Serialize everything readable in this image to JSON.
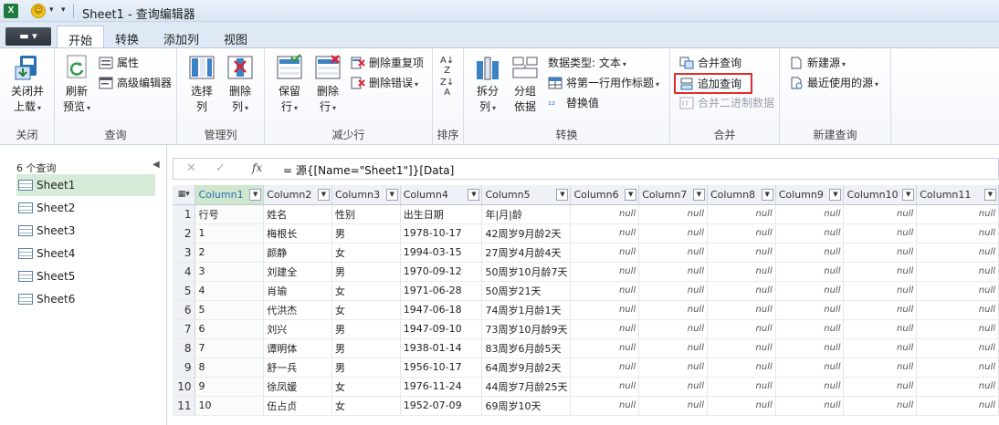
{
  "window": {
    "title": "Sheet1 - 查询编辑器",
    "app_logo_text": "X"
  },
  "tabs": [
    {
      "label": "开始",
      "active": true
    },
    {
      "label": "转换",
      "active": false
    },
    {
      "label": "添加列",
      "active": false
    },
    {
      "label": "视图",
      "active": false
    }
  ],
  "ribbon": {
    "close": {
      "btn_line1": "关闭并",
      "btn_line2": "上载",
      "group": "关闭"
    },
    "query": {
      "refresh_line1": "刷新",
      "refresh_line2": "预览",
      "properties": "属性",
      "advanced_editor": "高级编辑器",
      "group": "查询"
    },
    "manage_cols": {
      "select_line1": "选择",
      "select_line2": "列",
      "remove_line1": "删除",
      "remove_line2": "列",
      "group": "管理列"
    },
    "reduce_rows": {
      "keep_line1": "保留",
      "keep_line2": "行",
      "remove_line1": "删除",
      "remove_line2": "行",
      "remove_duplicates": "删除重复项",
      "remove_errors": "删除错误",
      "group": "减少行"
    },
    "sort": {
      "group": "排序"
    },
    "transform": {
      "split_line1": "拆分",
      "split_line2": "列",
      "group_line1": "分组",
      "group_line2": "依据",
      "data_type": "数据类型: 文本",
      "first_row_header": "将第一行用作标题",
      "replace_values": "替换值",
      "group": "转换"
    },
    "combine": {
      "merge_queries": "合并查询",
      "append_queries": "追加查询",
      "combine_binaries": "合并二进制数据",
      "group": "合并"
    },
    "new_query": {
      "new_source": "新建源",
      "recent_sources": "最近使用的源",
      "group": "新建查询"
    }
  },
  "sidebar": {
    "header": "6 个查询",
    "items": [
      "Sheet1",
      "Sheet2",
      "Sheet3",
      "Sheet4",
      "Sheet5",
      "Sheet6"
    ]
  },
  "formula_bar": {
    "cancel": "✕",
    "confirm": "✓",
    "fx": "fx",
    "formula": "= 源{[Name=\"Sheet1\"]}[Data]"
  },
  "grid": {
    "columns": [
      "Column1",
      "Column2",
      "Column3",
      "Column4",
      "Column5",
      "Column6",
      "Column7",
      "Column8",
      "Column9",
      "Column10",
      "Column11"
    ],
    "null_text": "null",
    "rows": [
      [
        "行号",
        "姓名",
        "性别",
        "出生日期",
        "年|月|龄"
      ],
      [
        "1",
        "梅根长",
        "男",
        "1978-10-17",
        "42周岁9月龄2天"
      ],
      [
        "2",
        "颜静",
        "女",
        "1994-03-15",
        "27周岁4月龄4天"
      ],
      [
        "3",
        "刘建全",
        "男",
        "1970-09-12",
        "50周岁10月龄7天"
      ],
      [
        "4",
        "肖瑜",
        "女",
        "1971-06-28",
        "50周岁21天"
      ],
      [
        "5",
        "代洪杰",
        "女",
        "1947-06-18",
        "74周岁1月龄1天"
      ],
      [
        "6",
        "刘兴",
        "男",
        "1947-09-10",
        "73周岁10月龄9天"
      ],
      [
        "7",
        "谭明体",
        "男",
        "1938-01-14",
        "83周岁6月龄5天"
      ],
      [
        "8",
        "舒一兵",
        "男",
        "1956-10-17",
        "64周岁9月龄2天"
      ],
      [
        "9",
        "徐凤媛",
        "女",
        "1976-11-24",
        "44周岁7月龄25天"
      ],
      [
        "10",
        "伍占贞",
        "女",
        "1952-07-09",
        "69周岁10天"
      ]
    ]
  }
}
